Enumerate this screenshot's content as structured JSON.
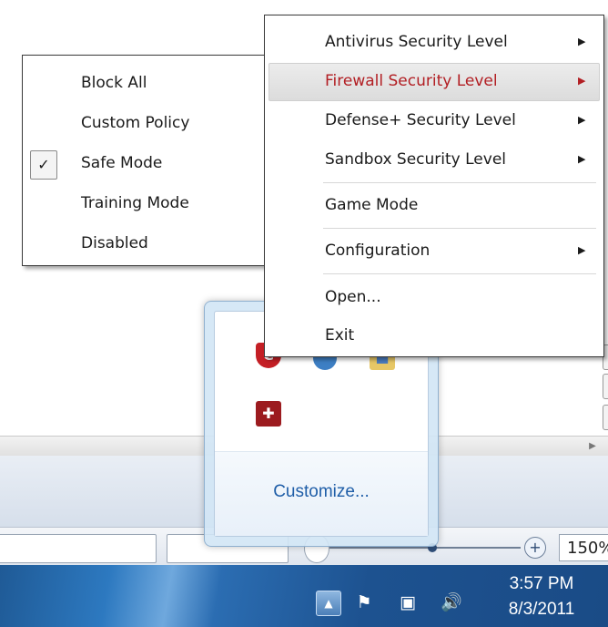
{
  "left_menu": {
    "items": [
      {
        "label": "Block All"
      },
      {
        "label": "Custom Policy"
      },
      {
        "label": "Safe Mode",
        "checked": true
      },
      {
        "label": "Training Mode"
      },
      {
        "label": "Disabled"
      }
    ]
  },
  "main_menu": {
    "items": [
      {
        "label": "Antivirus Security Level",
        "has_submenu": true
      },
      {
        "label": "Firewall Security Level",
        "has_submenu": true,
        "highlighted": true
      },
      {
        "label": "Defense+ Security Level",
        "has_submenu": true
      },
      {
        "label": "Sandbox Security Level",
        "has_submenu": true
      },
      {
        "label": "Game Mode"
      },
      {
        "label": "Configuration",
        "has_submenu": true
      },
      {
        "label": "Open..."
      },
      {
        "label": "Exit"
      }
    ]
  },
  "tray_popup": {
    "customize_label": "Customize...",
    "icons": [
      "comodo-shield-icon",
      "network-globe-icon",
      "folder-sync-icon",
      "puzzle-icon"
    ]
  },
  "statusbar": {
    "zoom_label": "150%"
  },
  "taskbar": {
    "time": "3:57 PM",
    "date": "8/3/2011",
    "icons": [
      "show-hidden-icons-icon",
      "action-center-flag-icon",
      "network-icon",
      "volume-icon"
    ]
  },
  "colors": {
    "highlight_text": "#b21e23",
    "taskbar_blue": "#1d5290",
    "link_blue": "#1f5ea8"
  }
}
